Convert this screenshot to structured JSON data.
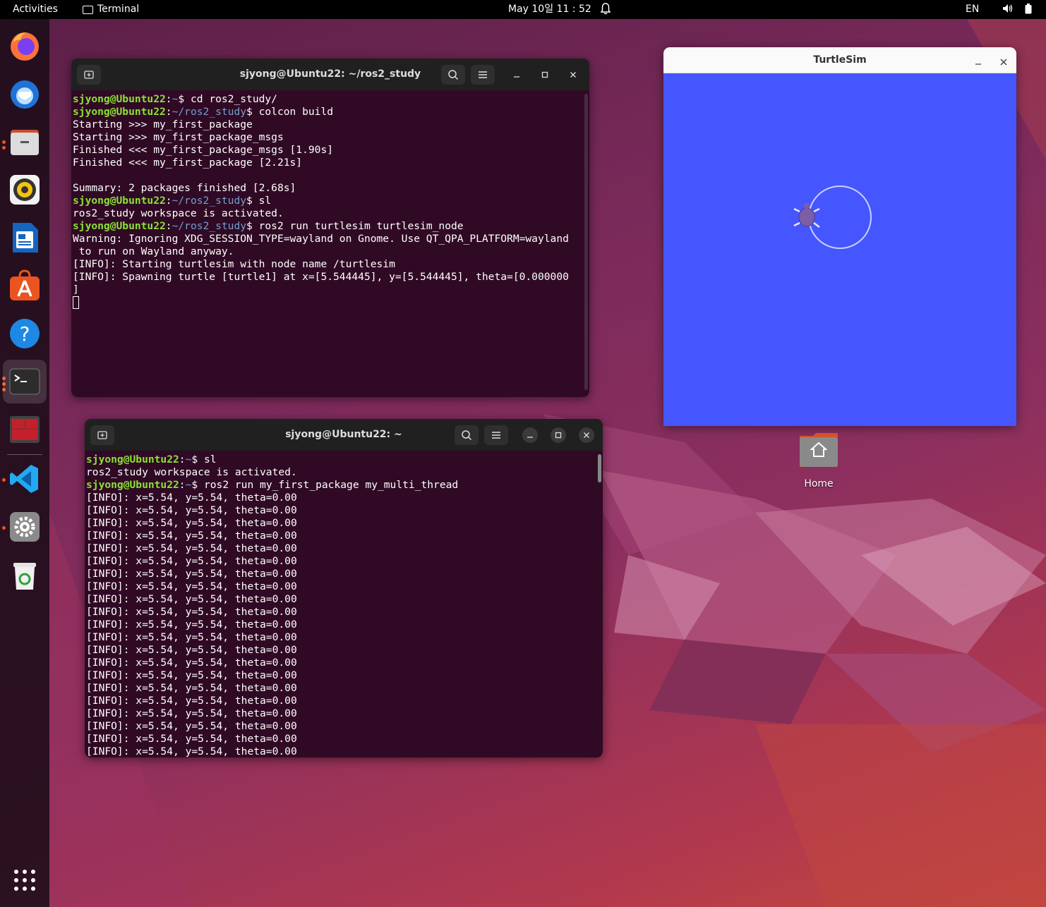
{
  "topbar": {
    "activities": "Activities",
    "app_name": "Terminal",
    "clock": "May 10일  11 : 52",
    "lang": "EN"
  },
  "dock": {
    "apps": [
      "firefox-icon",
      "thunderbird-icon",
      "files-icon",
      "rhythmbox-icon",
      "writer-icon",
      "software-icon",
      "help-icon",
      "terminal-icon",
      "terminator-icon",
      "vscode-icon",
      "settings-icon",
      "trash-icon",
      "show-apps-icon"
    ],
    "accent": "#e95420"
  },
  "term1": {
    "title": "sjyong@Ubuntu22: ~/ros2_study",
    "lines": [
      {
        "user": "sjyong@Ubuntu22",
        "path": "~",
        "cmd": "$ cd ros2_study/"
      },
      {
        "user": "sjyong@Ubuntu22",
        "path": "~/ros2_study",
        "cmd": "$ colcon build"
      },
      {
        "text": "Starting >>> my_first_package"
      },
      {
        "text": "Starting >>> my_first_package_msgs"
      },
      {
        "text": "Finished <<< my_first_package_msgs [1.90s]"
      },
      {
        "text": "Finished <<< my_first_package [2.21s]"
      },
      {
        "text": ""
      },
      {
        "text": "Summary: 2 packages finished [2.68s]"
      },
      {
        "user": "sjyong@Ubuntu22",
        "path": "~/ros2_study",
        "cmd": "$ sl"
      },
      {
        "text": "ros2_study workspace is activated."
      },
      {
        "user": "sjyong@Ubuntu22",
        "path": "~/ros2_study",
        "cmd": "$ ros2 run turtlesim turtlesim_node"
      },
      {
        "text": "Warning: Ignoring XDG_SESSION_TYPE=wayland on Gnome. Use QT_QPA_PLATFORM=wayland"
      },
      {
        "text": " to run on Wayland anyway."
      },
      {
        "text": "[INFO]: Starting turtlesim with node name /turtlesim"
      },
      {
        "text": "[INFO]: Spawning turtle [turtle1] at x=[5.544445], y=[5.544445], theta=[0.000000"
      },
      {
        "text": "]"
      }
    ]
  },
  "term2": {
    "title": "sjyong@Ubuntu22: ~",
    "lines": [
      {
        "user": "sjyong@Ubuntu22",
        "path": "~",
        "cmd": "$ sl"
      },
      {
        "text": "ros2_study workspace is activated."
      },
      {
        "user": "sjyong@Ubuntu22",
        "path": "~",
        "cmd": "$ ros2 run my_first_package my_multi_thread"
      },
      {
        "text": "[INFO]: x=5.54, y=5.54, theta=0.00"
      },
      {
        "text": "[INFO]: x=5.54, y=5.54, theta=0.00"
      },
      {
        "text": "[INFO]: x=5.54, y=5.54, theta=0.00"
      },
      {
        "text": "[INFO]: x=5.54, y=5.54, theta=0.00"
      },
      {
        "text": "[INFO]: x=5.54, y=5.54, theta=0.00"
      },
      {
        "text": "[INFO]: x=5.54, y=5.54, theta=0.00"
      },
      {
        "text": "[INFO]: x=5.54, y=5.54, theta=0.00"
      },
      {
        "text": "[INFO]: x=5.54, y=5.54, theta=0.00"
      },
      {
        "text": "[INFO]: x=5.54, y=5.54, theta=0.00"
      },
      {
        "text": "[INFO]: x=5.54, y=5.54, theta=0.00"
      },
      {
        "text": "[INFO]: x=5.54, y=5.54, theta=0.00"
      },
      {
        "text": "[INFO]: x=5.54, y=5.54, theta=0.00"
      },
      {
        "text": "[INFO]: x=5.54, y=5.54, theta=0.00"
      },
      {
        "text": "[INFO]: x=5.54, y=5.54, theta=0.00"
      },
      {
        "text": "[INFO]: x=5.54, y=5.54, theta=0.00"
      },
      {
        "text": "[INFO]: x=5.54, y=5.54, theta=0.00"
      },
      {
        "text": "[INFO]: x=5.54, y=5.54, theta=0.00"
      },
      {
        "text": "[INFO]: x=5.54, y=5.54, theta=0.00"
      },
      {
        "text": "[INFO]: x=5.54, y=5.54, theta=0.00"
      },
      {
        "text": "[INFO]: x=5.54, y=5.54, theta=0.00"
      },
      {
        "text": "[INFO]: x=5.54, y=5.54, theta=0.00"
      }
    ]
  },
  "turtlesim": {
    "title": "TurtleSim",
    "background": "#4556ff"
  },
  "desktop": {
    "home_label": "Home"
  },
  "colors": {
    "prompt_user": "#8ae234",
    "prompt_path": "#729fcf",
    "terminal_bg": "#300a24"
  }
}
